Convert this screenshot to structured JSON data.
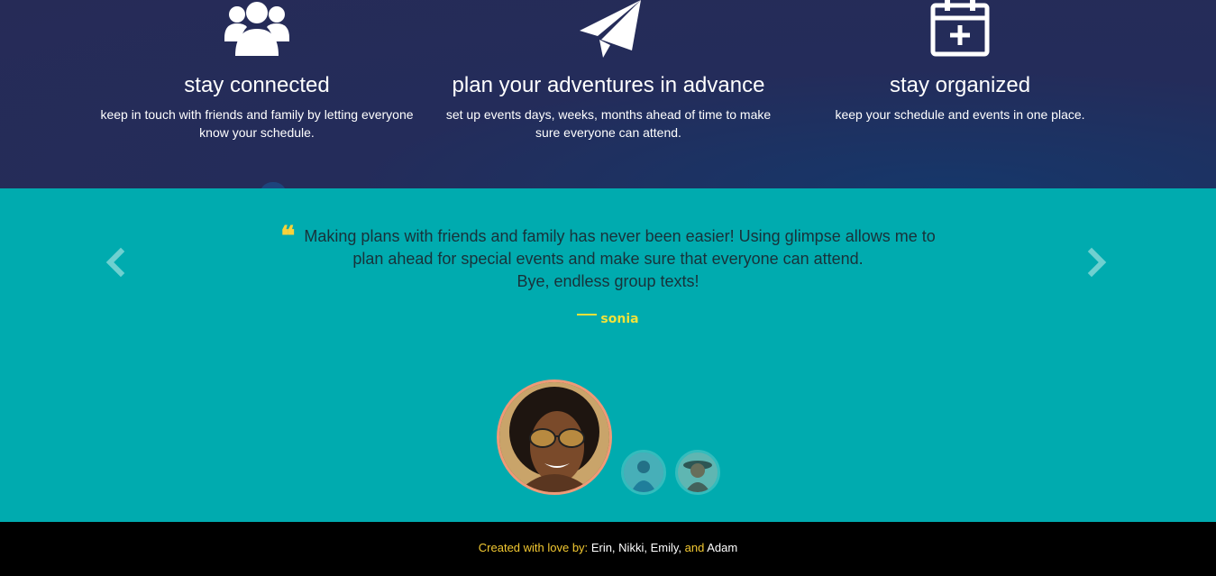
{
  "features": [
    {
      "icon": "users-icon",
      "title": "stay connected",
      "desc": "keep in touch with friends and family by letting everyone know your schedule."
    },
    {
      "icon": "paper-plane-icon",
      "title": "plan your adventures in advance",
      "desc": "set up events days, weeks, months ahead of time to make sure everyone can attend."
    },
    {
      "icon": "calendar-plus-icon",
      "title": "stay organized",
      "desc": "keep your schedule and events in one place."
    }
  ],
  "testimonial": {
    "quote_lines": [
      "Making plans with friends and family has never been easier! Using glimpse allows me to",
      "plan ahead for special events and make sure that everyone can attend.",
      "Bye, endless group texts!"
    ],
    "author": "sonia",
    "prev_icon": "chevron-left-icon",
    "next_icon": "chevron-right-icon"
  },
  "footer": {
    "prefix": "Created with love by:",
    "name1": "Erin,",
    "name2": "Nikki,",
    "name3": "Emily,",
    "conj": "and",
    "name4": "Adam"
  },
  "colors": {
    "features_bg": "#262b57",
    "testimonial_bg": "#00abaf",
    "quote_mark": "#f7d23a",
    "author": "#f2e23a",
    "footer_bg": "#000000",
    "footer_accent": "#f3c931",
    "avatar_border": "#ee9a78"
  }
}
